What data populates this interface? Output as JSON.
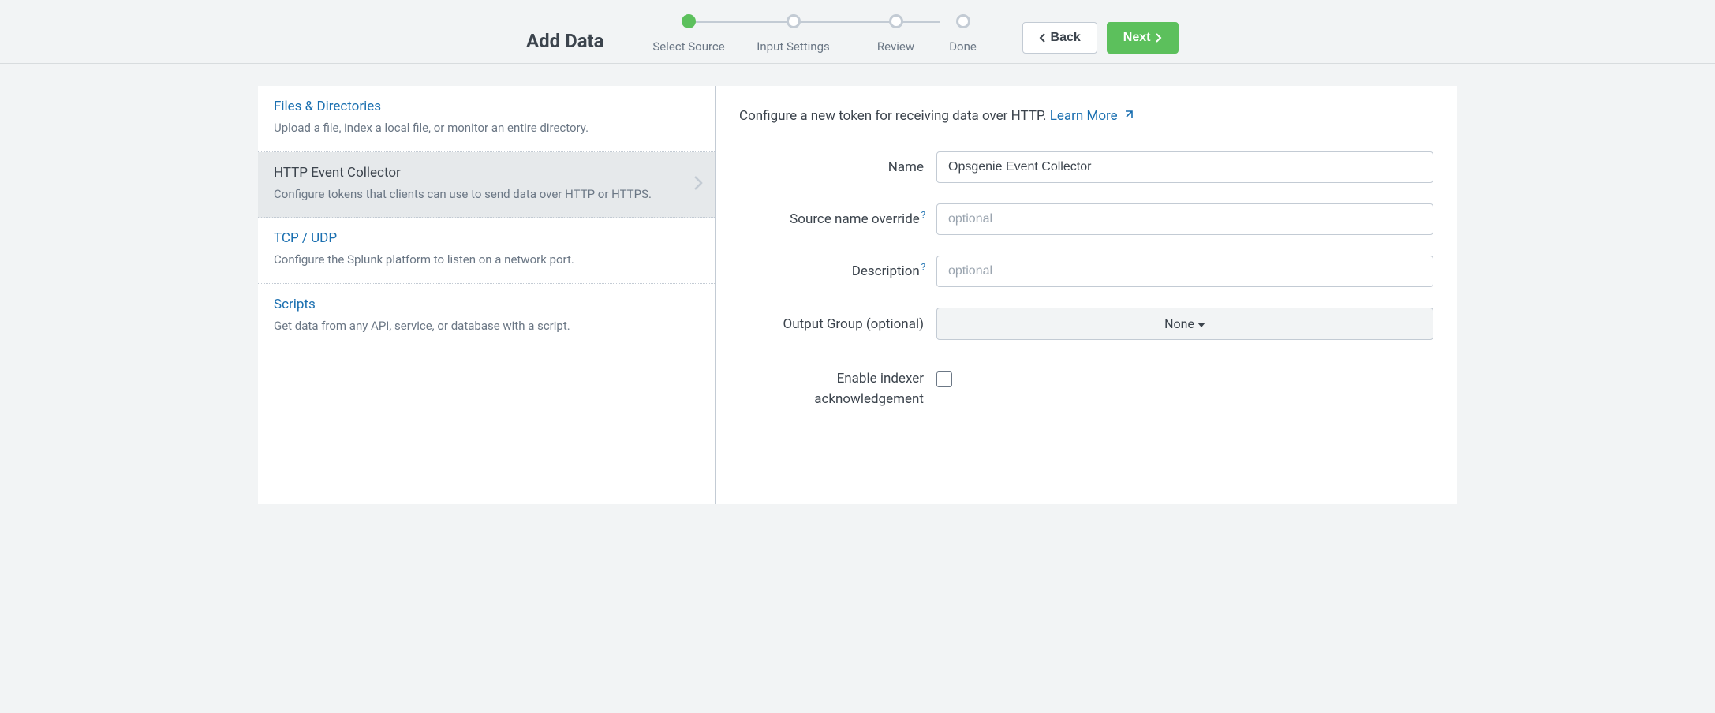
{
  "header": {
    "title": "Add Data",
    "steps": [
      "Select Source",
      "Input Settings",
      "Review",
      "Done"
    ],
    "back_label": "Back",
    "next_label": "Next"
  },
  "sidebar": {
    "items": [
      {
        "title": "Files & Directories",
        "desc": "Upload a file, index a local file, or monitor an entire directory."
      },
      {
        "title": "HTTP Event Collector",
        "desc": "Configure tokens that clients can use to send data over HTTP or HTTPS."
      },
      {
        "title": "TCP / UDP",
        "desc": "Configure the Splunk platform to listen on a network port."
      },
      {
        "title": "Scripts",
        "desc": "Get data from any API, service, or database with a script."
      }
    ],
    "selected_index": 1
  },
  "main": {
    "intro_text": "Configure a new token for receiving data over HTTP. ",
    "learn_more": "Learn More",
    "labels": {
      "name": "Name",
      "source_name_override": "Source name override",
      "description": "Description",
      "output_group": "Output Group (optional)",
      "enable_indexer_ack": "Enable indexer acknowledgement"
    },
    "values": {
      "name": "Opsgenie Event Collector",
      "source_name_override": "",
      "description": "",
      "output_group": "None",
      "enable_indexer_ack": false
    },
    "placeholders": {
      "source_name_override": "optional",
      "description": "optional"
    }
  }
}
